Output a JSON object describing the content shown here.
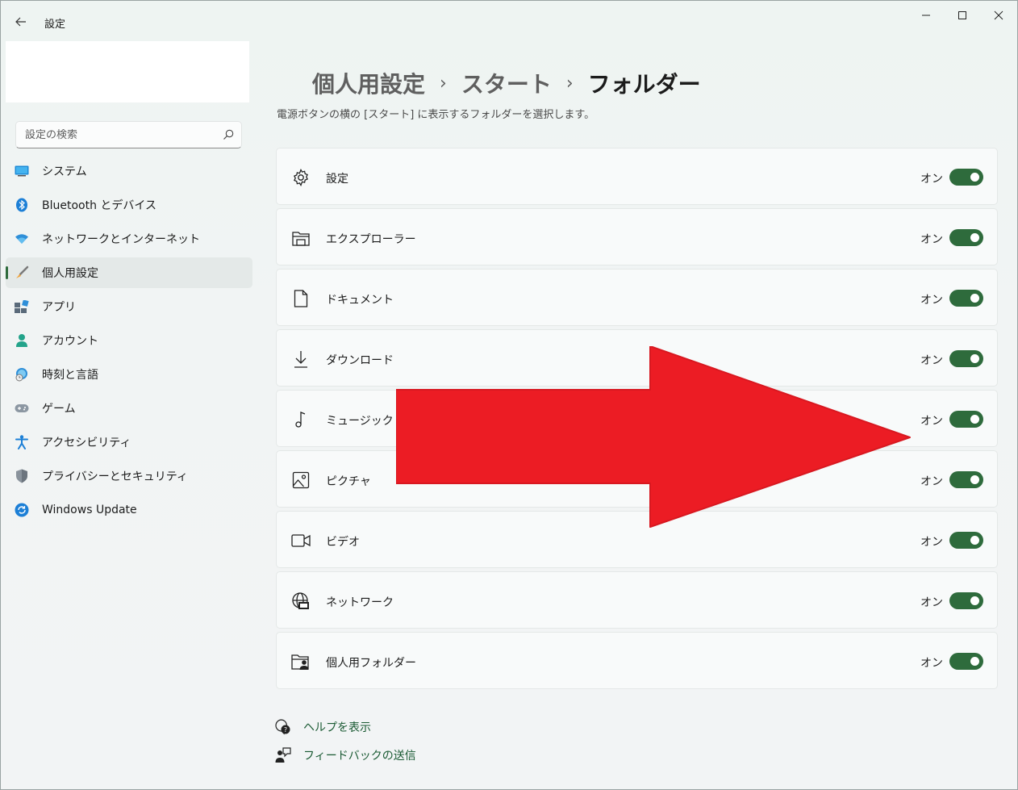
{
  "window": {
    "title": "設定"
  },
  "sidebar": {
    "search": {
      "placeholder": "設定の検索"
    },
    "items": [
      {
        "label": "システム",
        "icon": "system-icon"
      },
      {
        "label": "Bluetooth とデバイス",
        "icon": "bluetooth-icon"
      },
      {
        "label": "ネットワークとインターネット",
        "icon": "wifi-icon"
      },
      {
        "label": "個人用設定",
        "icon": "brush-icon",
        "selected": true
      },
      {
        "label": "アプリ",
        "icon": "apps-icon"
      },
      {
        "label": "アカウント",
        "icon": "account-icon"
      },
      {
        "label": "時刻と言語",
        "icon": "time-language-icon"
      },
      {
        "label": "ゲーム",
        "icon": "gamepad-icon"
      },
      {
        "label": "アクセシビリティ",
        "icon": "accessibility-icon"
      },
      {
        "label": "プライバシーとセキュリティ",
        "icon": "shield-icon"
      },
      {
        "label": "Windows Update",
        "icon": "update-icon"
      }
    ]
  },
  "main": {
    "breadcrumb": {
      "level1": "個人用設定",
      "level2": "スタート",
      "current": "フォルダー",
      "separator": "›"
    },
    "subtitle": "電源ボタンの横の [スタート] に表示するフォルダーを選択します。",
    "folders": [
      {
        "label": "設定",
        "state": "オン",
        "on": true,
        "icon": "gear-icon"
      },
      {
        "label": "エクスプローラー",
        "state": "オン",
        "on": true,
        "icon": "explorer-icon"
      },
      {
        "label": "ドキュメント",
        "state": "オン",
        "on": true,
        "icon": "document-icon"
      },
      {
        "label": "ダウンロード",
        "state": "オン",
        "on": true,
        "icon": "download-icon"
      },
      {
        "label": "ミュージック",
        "state": "オン",
        "on": true,
        "icon": "music-icon"
      },
      {
        "label": "ピクチャ",
        "state": "オン",
        "on": true,
        "icon": "picture-icon"
      },
      {
        "label": "ビデオ",
        "state": "オン",
        "on": true,
        "icon": "video-icon"
      },
      {
        "label": "ネットワーク",
        "state": "オン",
        "on": true,
        "icon": "network-icon"
      },
      {
        "label": "個人用フォルダー",
        "state": "オン",
        "on": true,
        "icon": "personal-folder-icon"
      }
    ],
    "links": {
      "help": "ヘルプを表示",
      "feedback": "フィードバックの送信"
    }
  },
  "colors": {
    "accent": "#2e6b3c",
    "annotation_arrow": "#ec1c24"
  }
}
